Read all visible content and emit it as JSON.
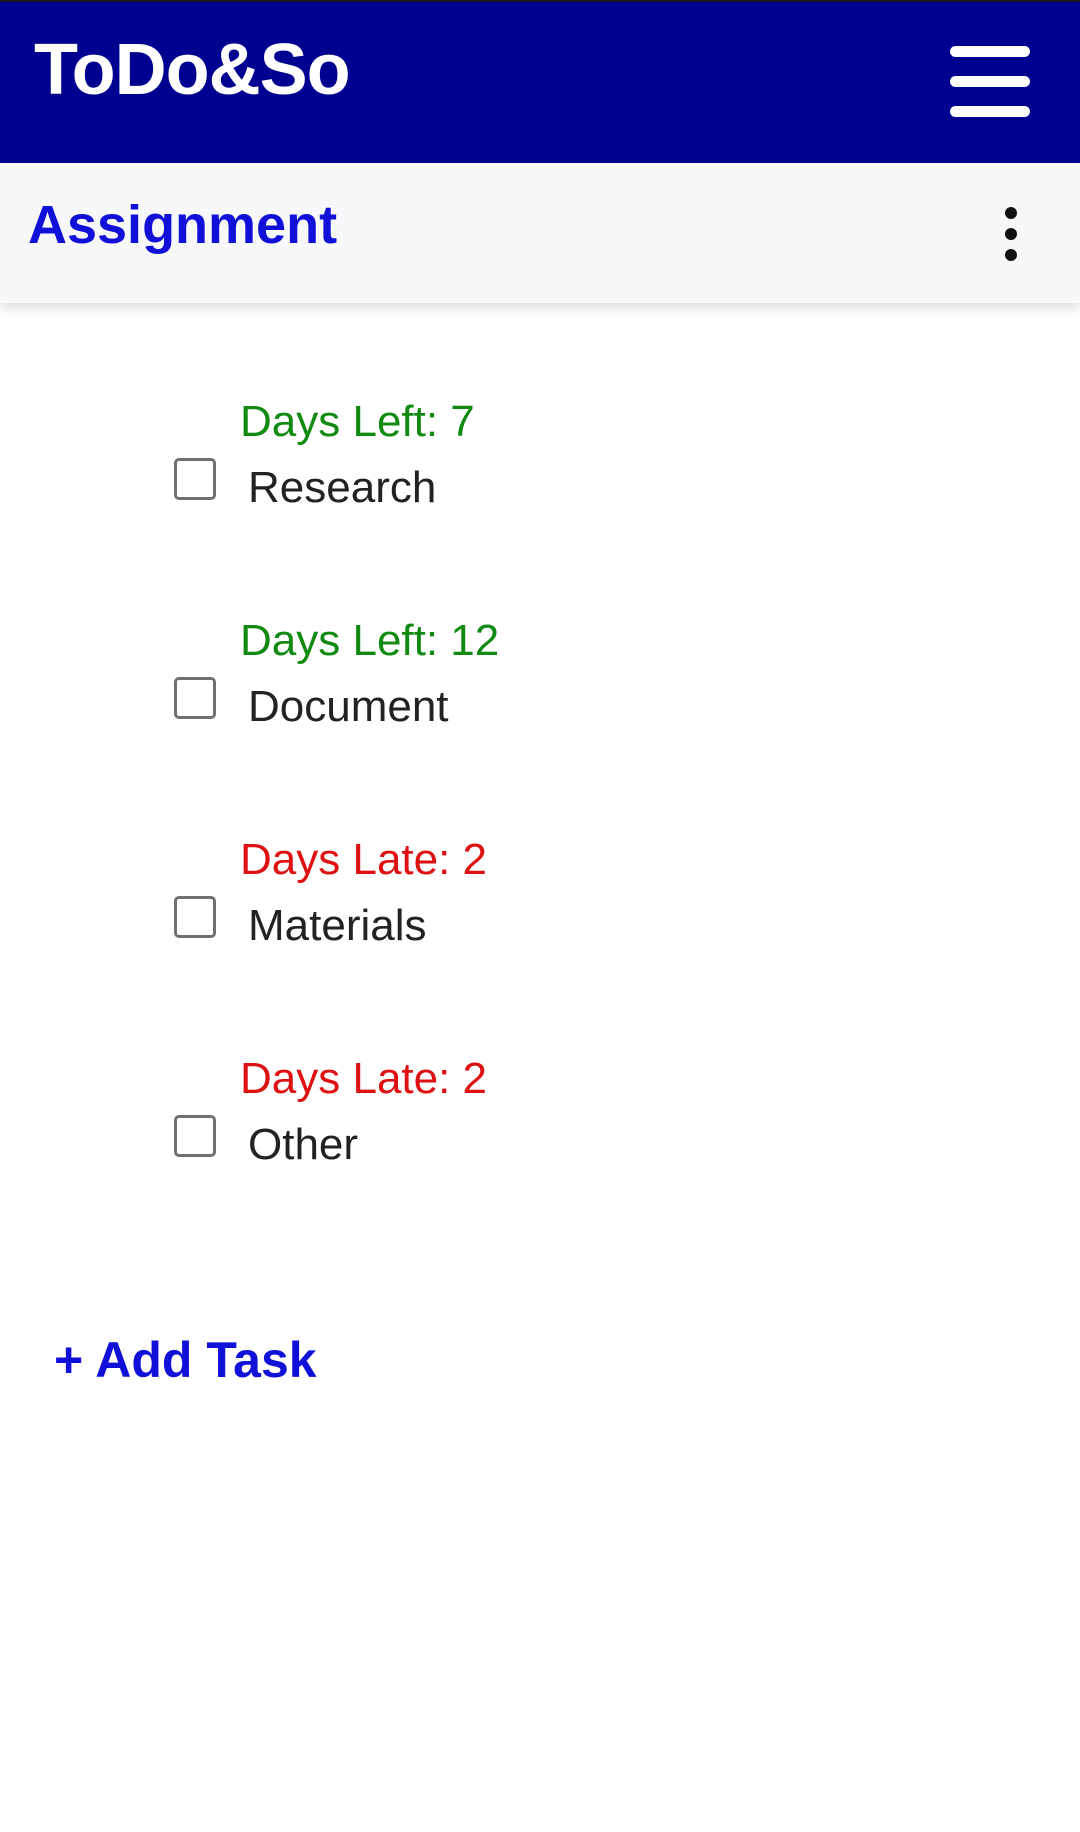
{
  "header": {
    "app_title": "ToDo&So",
    "menu_icon": "hamburger-menu-icon",
    "background_color": "#000090"
  },
  "list": {
    "title": "Assignment",
    "more_icon": "more-vert-icon",
    "title_color": "#1010d8"
  },
  "tasks": [
    {
      "status": "Days Left: 7",
      "status_type": "left",
      "name": "Research",
      "checked": false
    },
    {
      "status": "Days Left: 12",
      "status_type": "left",
      "name": "Document",
      "checked": false
    },
    {
      "status": "Days Late: 2",
      "status_type": "late",
      "name": "Materials",
      "checked": false
    },
    {
      "status": "Days Late: 2",
      "status_type": "late",
      "name": "Other",
      "checked": false
    }
  ],
  "actions": {
    "add_task_label": "+ Add Task"
  },
  "colors": {
    "days_left": "#118a11",
    "days_late": "#dd1111"
  }
}
